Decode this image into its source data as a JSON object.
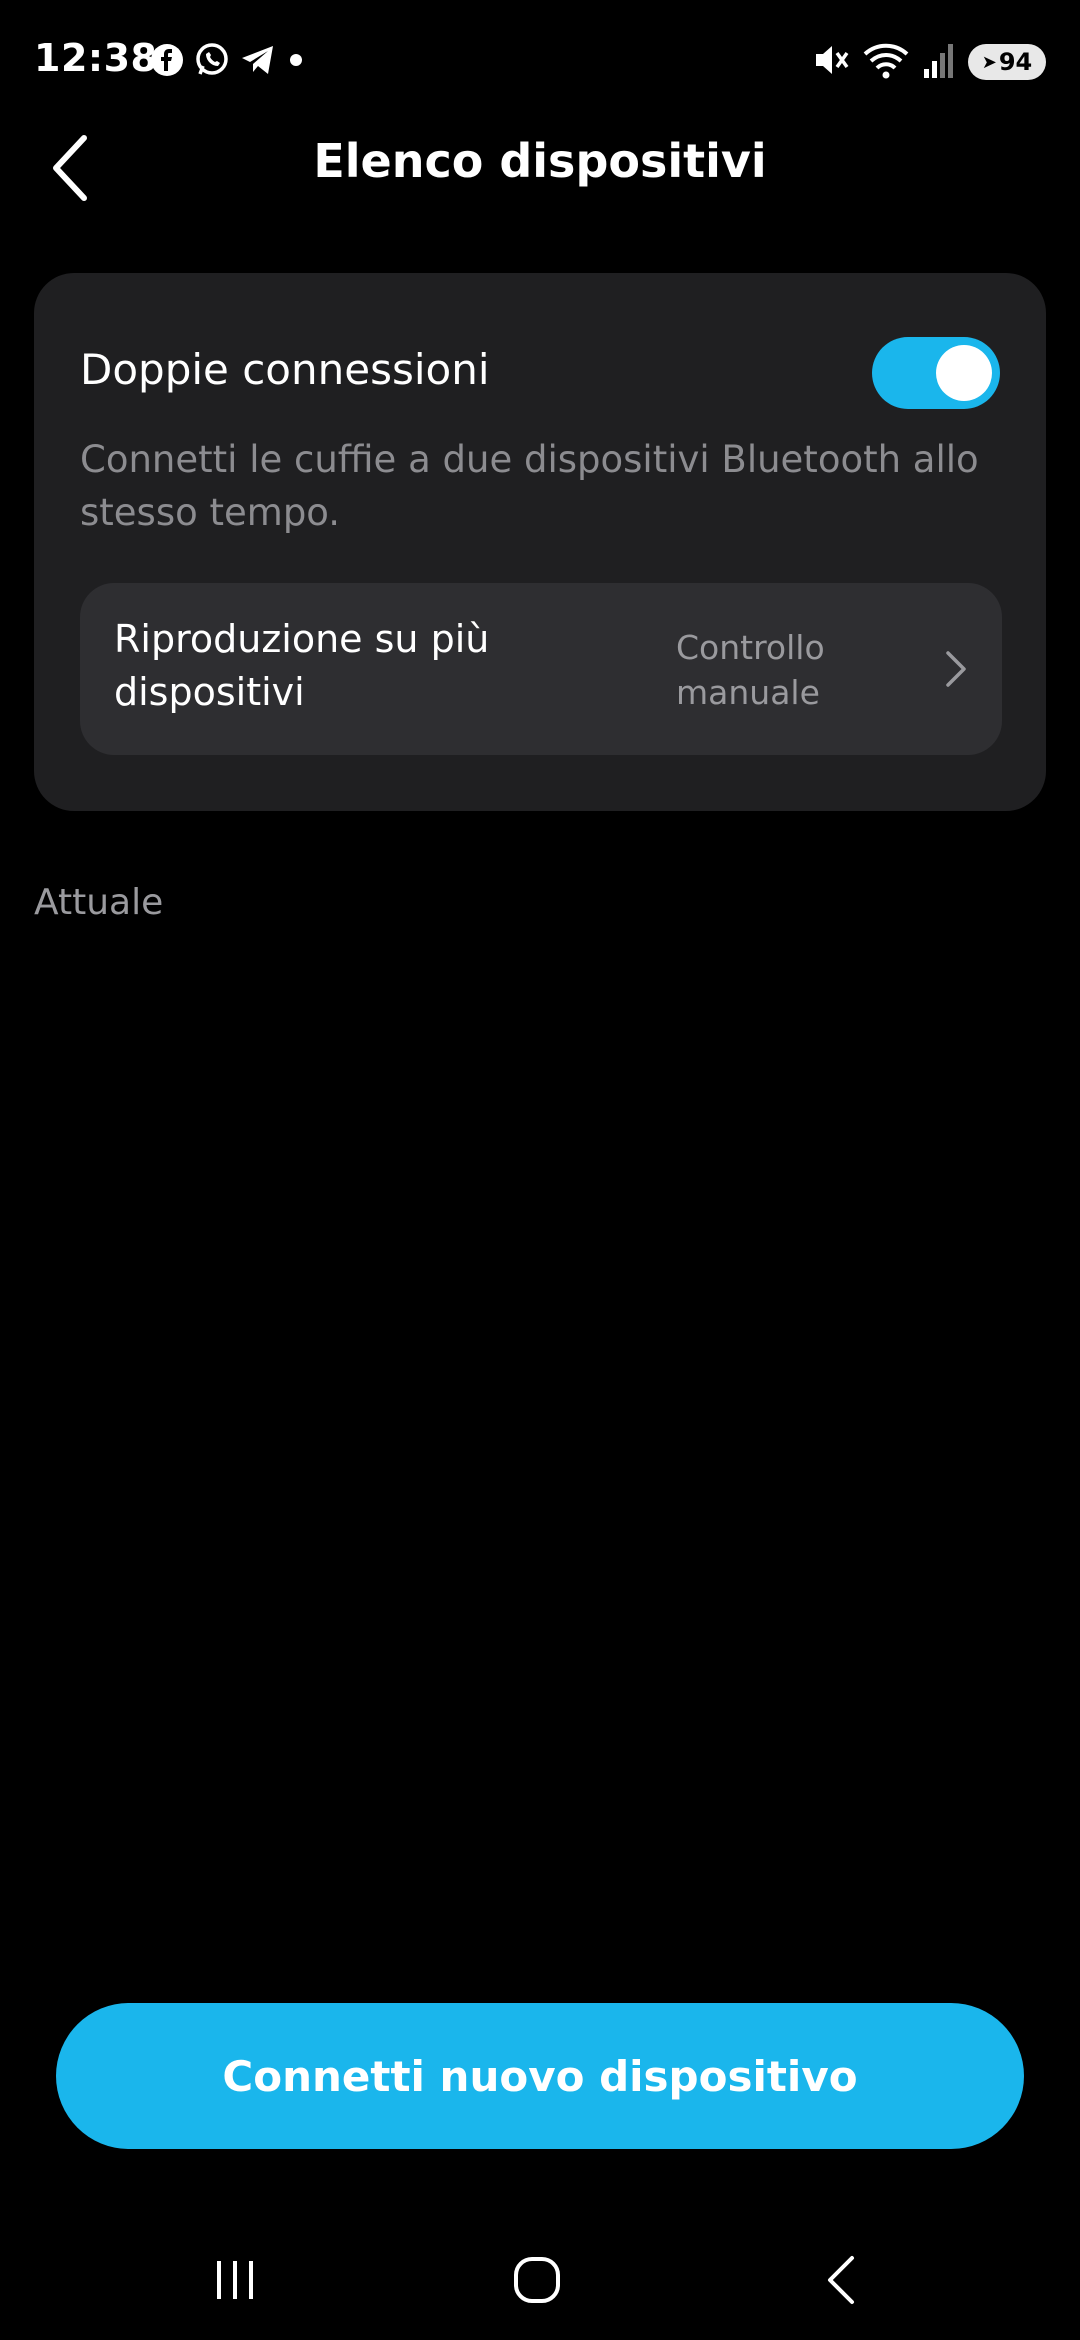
{
  "status_bar": {
    "time": "12:38",
    "battery": "94",
    "left_icons": [
      "facebook-icon",
      "whatsapp-icon",
      "telegram-icon",
      "dot-icon"
    ],
    "right_icons": [
      "mute-icon",
      "wifi-icon",
      "signal-icon",
      "battery-icon"
    ]
  },
  "header": {
    "title": "Elenco dispositivi"
  },
  "dual_connection": {
    "title": "Doppie connessioni",
    "enabled": true,
    "description": "Connetti le cuffie a due dispositivi Bluetooth allo stesso tempo.",
    "multi_playback": {
      "label": "Riproduzione su più dispositivi",
      "value": "Controllo manuale"
    }
  },
  "section": {
    "current_label": "Attuale"
  },
  "actions": {
    "connect_new": "Connetti nuovo dispositivo"
  },
  "colors": {
    "accent": "#1ab6ec",
    "background": "#000000",
    "card": "#1f1f21",
    "row": "#2e2e31"
  }
}
